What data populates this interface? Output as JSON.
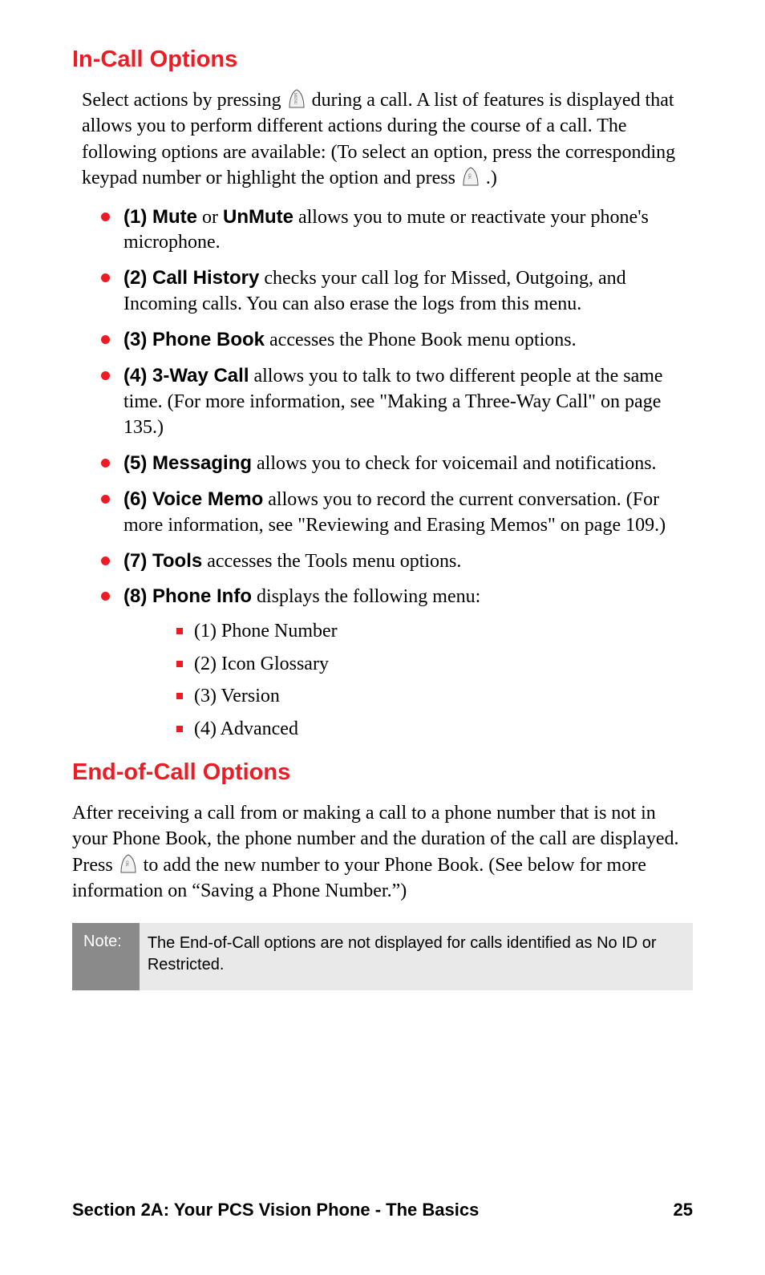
{
  "headings": {
    "h1": "In-Call Options",
    "h2": "End-of-Call Options"
  },
  "intro": {
    "seg1": "Select actions by pressing ",
    "seg2": " during a call. A list of features is displayed that allows you to perform different actions during the course of a call. The following options are available: (To select an option, press the corresponding keypad number or highlight the option and press ",
    "seg3": ".)"
  },
  "options": [
    {
      "title": "(1) Mute",
      "title2": " or ",
      "title3": "UnMute",
      "desc": " allows you to mute or reactivate your phone's microphone."
    },
    {
      "title": "(2) Call History",
      "desc": " checks your call log for Missed, Outgoing, and Incoming calls. You can also erase the logs from this menu."
    },
    {
      "title": "(3) Phone Book",
      "desc": " accesses the Phone Book menu options."
    },
    {
      "title": "(4) 3-Way Call",
      "desc": " allows you to talk to two different people at the same time. (For more information, see \"Making a Three-Way Call\" on page 135.)"
    },
    {
      "title": "(5) Messaging",
      "desc": " allows you to check for voicemail and notifications."
    },
    {
      "title": "(6) Voice Memo",
      "desc": " allows you to record the current conversation. (For more information, see \"Reviewing and Erasing Memos\" on page 109.)"
    },
    {
      "title": "(7) Tools",
      "desc": " accesses the Tools menu options."
    },
    {
      "title": "(8) Phone Info",
      "desc": " displays the following menu:"
    }
  ],
  "phone_info_sub": [
    "(1) Phone Number",
    "(2) Icon Glossary",
    "(3) Version",
    "(4) Advanced"
  ],
  "end_of_call": {
    "seg1": "After receiving a call from or making a call to a phone number that is not in your Phone Book, the phone number and the duration of the call are displayed. Press ",
    "seg2": " to add the new number to your Phone Book. (See below for more information on “Saving a Phone Number.”)"
  },
  "note": {
    "label": "Note:",
    "text": "The End-of-Call options are not displayed for calls identified as No ID or Restricted."
  },
  "footer": {
    "section": "Section 2A: Your PCS Vision Phone - The Basics",
    "page": "25"
  }
}
